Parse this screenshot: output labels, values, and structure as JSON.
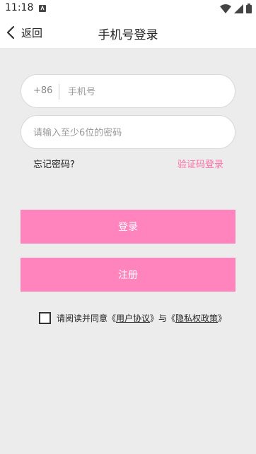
{
  "status_bar": {
    "time": "11:18"
  },
  "header": {
    "back_label": "返回",
    "title": "手机号登录"
  },
  "phone": {
    "country_code": "+86",
    "placeholder": "手机号"
  },
  "password": {
    "placeholder": "请输入至少6位的密码"
  },
  "links": {
    "forgot": "忘记密码?",
    "sms_login": "验证码登录"
  },
  "buttons": {
    "login": "登录",
    "register": "注册"
  },
  "agreement": {
    "prefix": "请阅读并同意《",
    "user_agreement": "用户协议",
    "middle": "》与《",
    "privacy_policy": "隐私权政策",
    "suffix": "》"
  },
  "colors": {
    "accent": "#ff83bc",
    "link_pink": "#ff6fa3",
    "background": "#ececec"
  },
  "icons": {
    "back": "chevron-left-icon",
    "wifi": "wifi-icon",
    "signal": "signal-icon",
    "battery": "battery-icon"
  }
}
